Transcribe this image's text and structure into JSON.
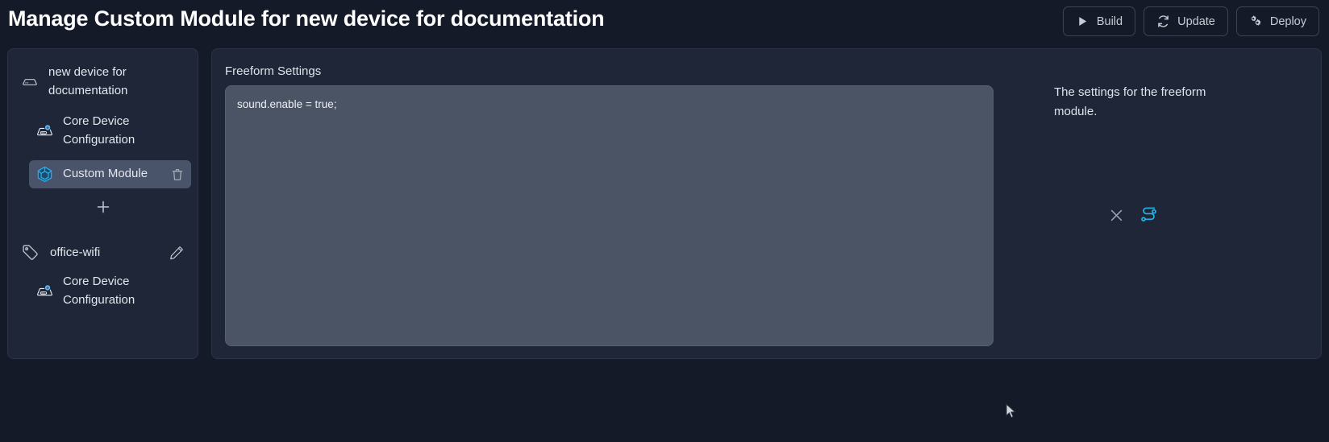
{
  "header": {
    "title": "Manage Custom Module for new device for documentation",
    "actions": [
      {
        "label": "Build",
        "icon": "play-icon"
      },
      {
        "label": "Update",
        "icon": "refresh-icon"
      },
      {
        "label": "Deploy",
        "icon": "gears-icon"
      }
    ]
  },
  "sidebar": {
    "device": {
      "label": "new device for documentation",
      "icon": "device-icon"
    },
    "device_children": [
      {
        "label": "Core Device Configuration",
        "icon": "core-device-config-icon",
        "selected": false,
        "deletable": false
      },
      {
        "label": "Custom Module",
        "icon": "custom-module-cube-icon",
        "selected": true,
        "deletable": true
      }
    ],
    "add_label": "+",
    "tag": {
      "label": "office-wifi",
      "icon": "tag-icon",
      "edit_icon": "pencil-icon"
    },
    "tag_children": [
      {
        "label": "Core Device Configuration",
        "icon": "core-device-config-icon",
        "selected": false,
        "deletable": false
      }
    ]
  },
  "main": {
    "field_label": "Freeform Settings",
    "freeform_value": "sound.enable = true;",
    "freeform_placeholder": "",
    "description": "The settings for the freeform module.",
    "side_icons": [
      {
        "name": "close-icon",
        "color": "#9aa3b2"
      },
      {
        "name": "workflow-icon",
        "color": "#25b6e8"
      }
    ]
  },
  "colors": {
    "page_bg": "#141a28",
    "panel_bg": "#1e2637",
    "panel_border": "#2b3447",
    "textarea_bg": "#4b5464",
    "selected_row": "#49536a",
    "accent_blue": "#25b6e8",
    "text": "#e3e7ee",
    "muted_text": "#9aa3b2"
  }
}
